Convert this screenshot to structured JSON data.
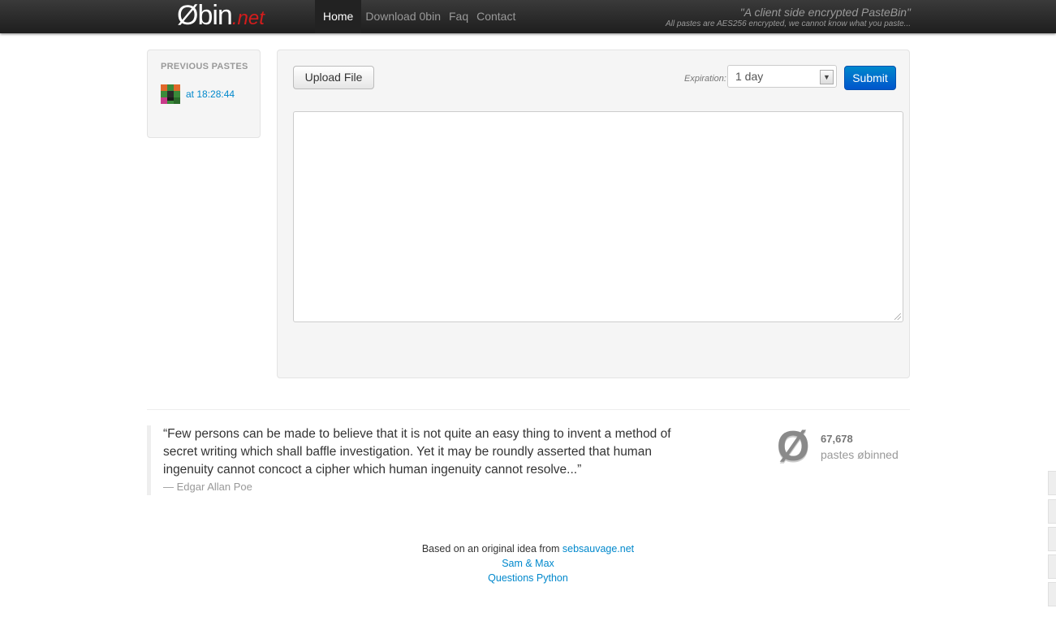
{
  "header": {
    "brand_main": "Øbin",
    "brand_suffix": ".net",
    "nav": [
      {
        "label": "Home",
        "active": true
      },
      {
        "label": "Download 0bin"
      },
      {
        "label": "Faq"
      },
      {
        "label": "Contact"
      }
    ],
    "tagline": "\"A client side encrypted PasteBin\"",
    "subtagline": "All pastes are AES256 encrypted, we cannot know what you paste..."
  },
  "sidebar": {
    "title": "PREVIOUS PASTES",
    "items": [
      {
        "time": "at 18:28:44"
      }
    ]
  },
  "form": {
    "upload_label": "Upload File",
    "expiration_label": "Expiration:",
    "expiration_value": "1 day",
    "submit_label": "Submit",
    "paste_content": ""
  },
  "quote": {
    "text": "“Few persons can be made to believe that it is not quite an easy thing to invent a method of secret writing which shall baffle investigation. Yet it may be roundly asserted that human ingenuity cannot concoct a cipher which human ingenuity cannot resolve...”",
    "author": "— Edgar Allan Poe"
  },
  "stats": {
    "symbol": "Ø",
    "count": "67,678",
    "label": "pastes øbinned"
  },
  "footer": {
    "line1_prefix": "Based on an original idea from",
    "line1_link": "sebsauvage.net",
    "line2_link": "Sam & Max",
    "line3_link": "Questions Python"
  },
  "colors": {
    "accent_blue": "#0088cc",
    "brand_red": "#d41c1c",
    "navbar": "#222222"
  }
}
